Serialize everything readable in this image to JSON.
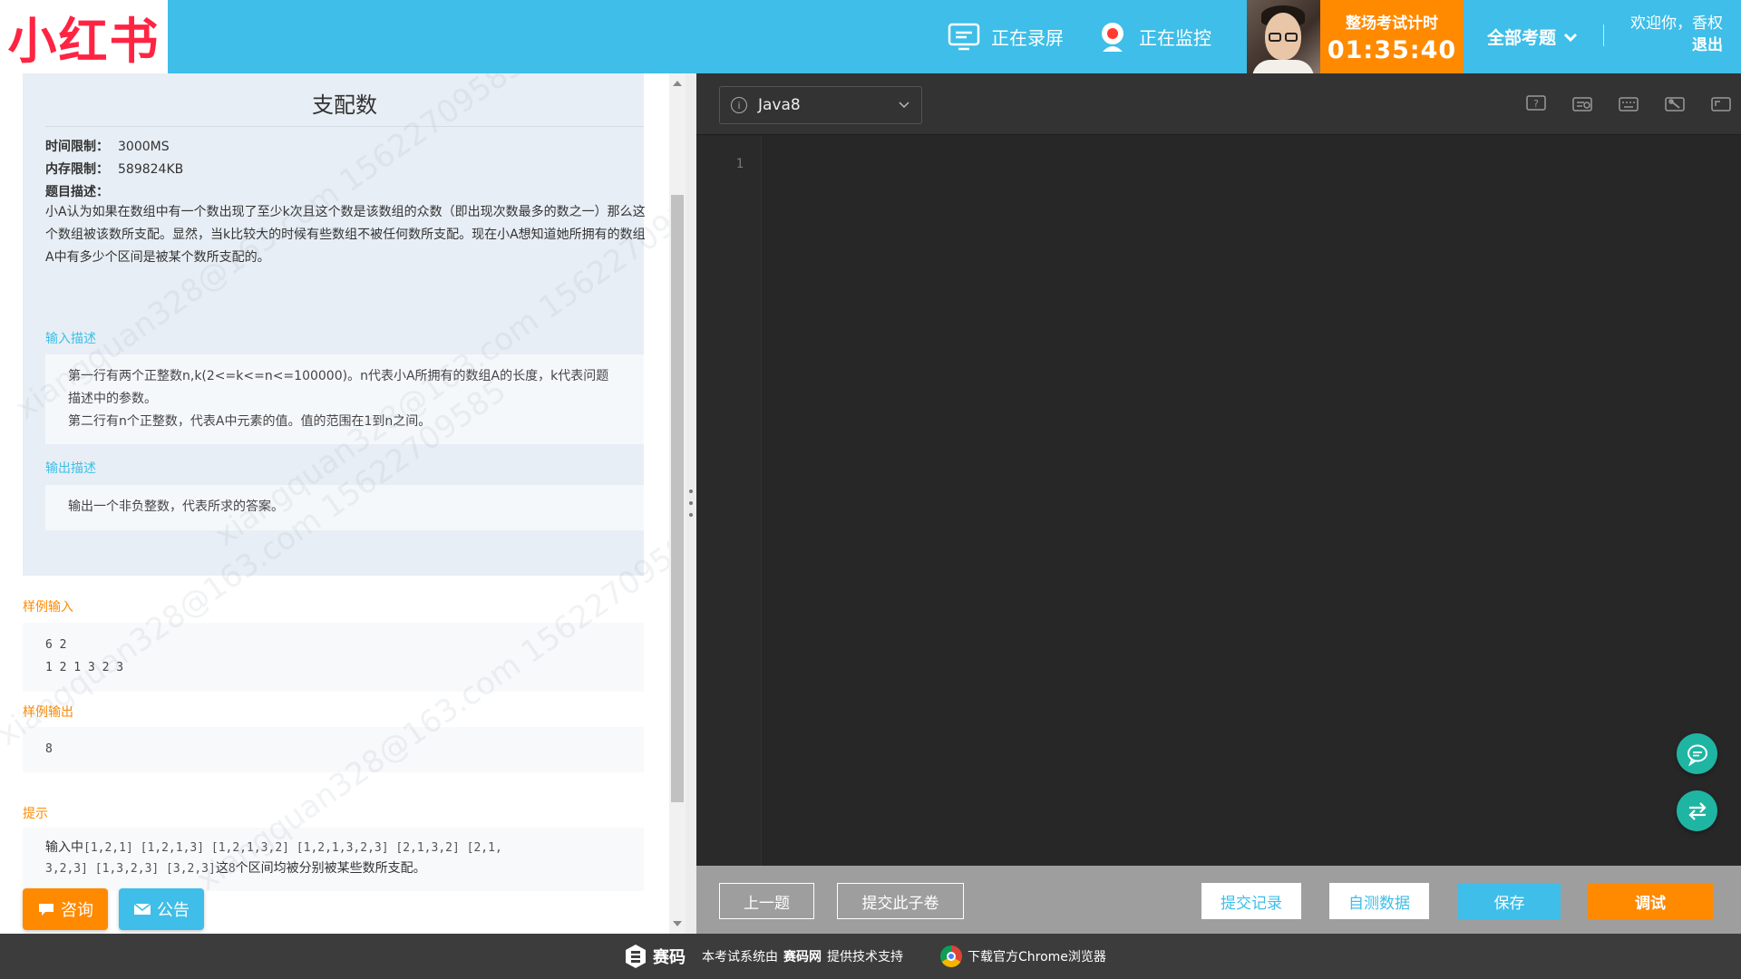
{
  "header": {
    "logo_text": "小红书",
    "recording_label": "正在录屏",
    "monitoring_label": "正在监控",
    "timer_label": "整场考试计时",
    "timer_value": "01:35:40",
    "all_questions_label": "全部考题",
    "welcome_text": "欢迎你，香权",
    "logout_label": "退出"
  },
  "problem": {
    "title": "支配数",
    "time_limit_label": "时间限制：",
    "time_limit_value": "3000MS",
    "memory_limit_label": "内存限制：",
    "memory_limit_value": "589824KB",
    "desc_label": "题目描述：",
    "description": "小A认为如果在数组中有一个数出现了至少k次且这个数是该数组的众数（即出现次数最多的数之一）那么这个数组被该数所支配。显然，当k比较大的时候有些数组不被任何数所支配。现在小A想知道她所拥有的数组A中有多少个区间是被某个数所支配的。",
    "input_label": "输入描述",
    "input_line1": "第一行有两个正整数n,k(2<=k<=n<=100000)。n代表小A所拥有的数组A的长度，k代表问题描述中的参数。",
    "input_line2": "第二行有n个正整数，代表A中元素的值。值的范围在1到n之间。",
    "output_label": "输出描述",
    "output_text": "输出一个非负整数，代表所求的答案。",
    "sample_input_label": "样例输入",
    "sample_input_line1": "6 2",
    "sample_input_line2": "1 2 1 3 2 3",
    "sample_output_label": "样例输出",
    "sample_output": "8",
    "hint_label": "提示",
    "hint_prefix": "输入中",
    "hint_code1": "[1,2,1] [1,2,1,3] [1,2,1,3,2] [1,2,1,3,2,3] [2,1,3,2] [2,1,",
    "hint_code2": "3,2,3] [1,3,2,3] [3,2,3]",
    "hint_suffix_pre": "这",
    "hint_suffix_num": "8",
    "hint_suffix": "个区间均被分别被某些数所支配。"
  },
  "watermark_text": "xiangquan328@163.com 15622709585",
  "left_buttons": {
    "consult_label": "咨询",
    "notice_label": "公告"
  },
  "editor": {
    "language": "Java8",
    "line_number": "1",
    "tool_icons": [
      "help-icon",
      "reset-icon",
      "keyboard-icon",
      "settings-icon",
      "fullscreen-icon"
    ]
  },
  "actions": {
    "prev_label": "上一题",
    "submit_paper_label": "提交此子卷",
    "submit_history_label": "提交记录",
    "self_test_label": "自测数据",
    "save_label": "保存",
    "debug_label": "调试"
  },
  "footer": {
    "brand_name": "赛码",
    "support_prefix": "本考试系统由",
    "support_brand": "赛码网",
    "support_suffix": "提供技术支持",
    "chrome_label": "下载官方Chrome浏览器"
  },
  "colors": {
    "primary": "#3ebee8",
    "accent": "#ff8a00",
    "logo": "#ff2442",
    "float_button": "#1fb5a3",
    "editor_bg": "#272727"
  }
}
